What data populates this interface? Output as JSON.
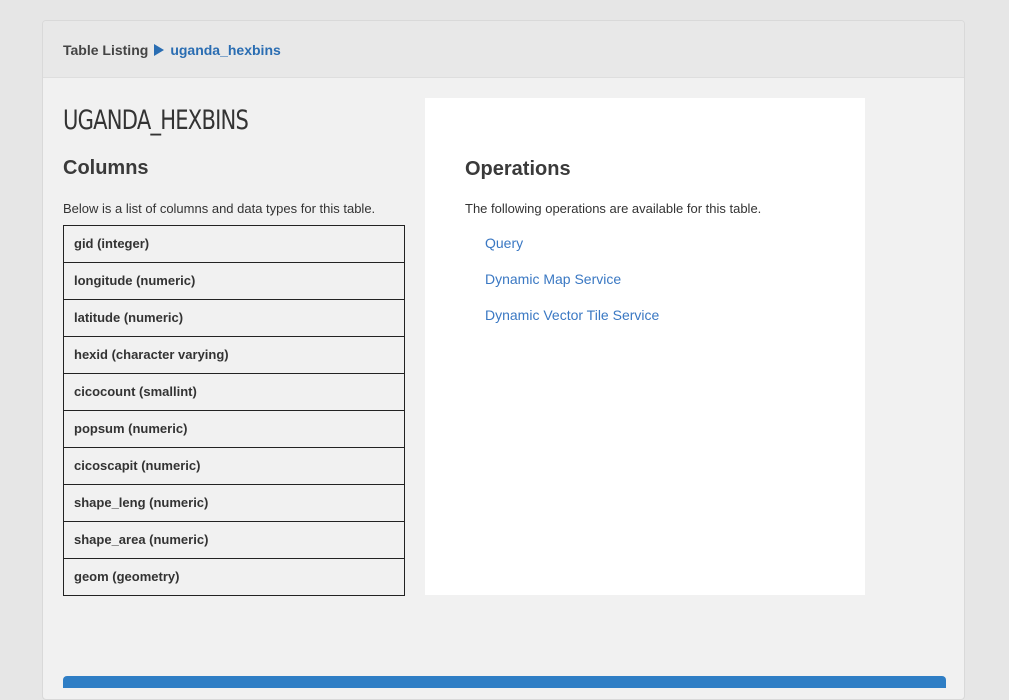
{
  "breadcrumb": {
    "root_label": "Table Listing",
    "current_label": "uganda_hexbins"
  },
  "table": {
    "title": "UGANDA_HEXBINS"
  },
  "columns": {
    "heading": "Columns",
    "description": "Below is a list of columns and data types for this table.",
    "items": [
      "gid (integer)",
      "longitude (numeric)",
      "latitude (numeric)",
      "hexid (character varying)",
      "cicocount (smallint)",
      "popsum (numeric)",
      "cicoscapit (numeric)",
      "shape_leng (numeric)",
      "shape_area (numeric)",
      "geom (geometry)"
    ]
  },
  "operations": {
    "heading": "Operations",
    "description": "The following operations are available for this table.",
    "links": [
      "Query",
      "Dynamic Map Service",
      "Dynamic Vector Tile Service"
    ]
  },
  "colors": {
    "link": "#3a78c3",
    "breadcrumb_link": "#2a6db2",
    "bottom_bar": "#2f7ec5"
  }
}
